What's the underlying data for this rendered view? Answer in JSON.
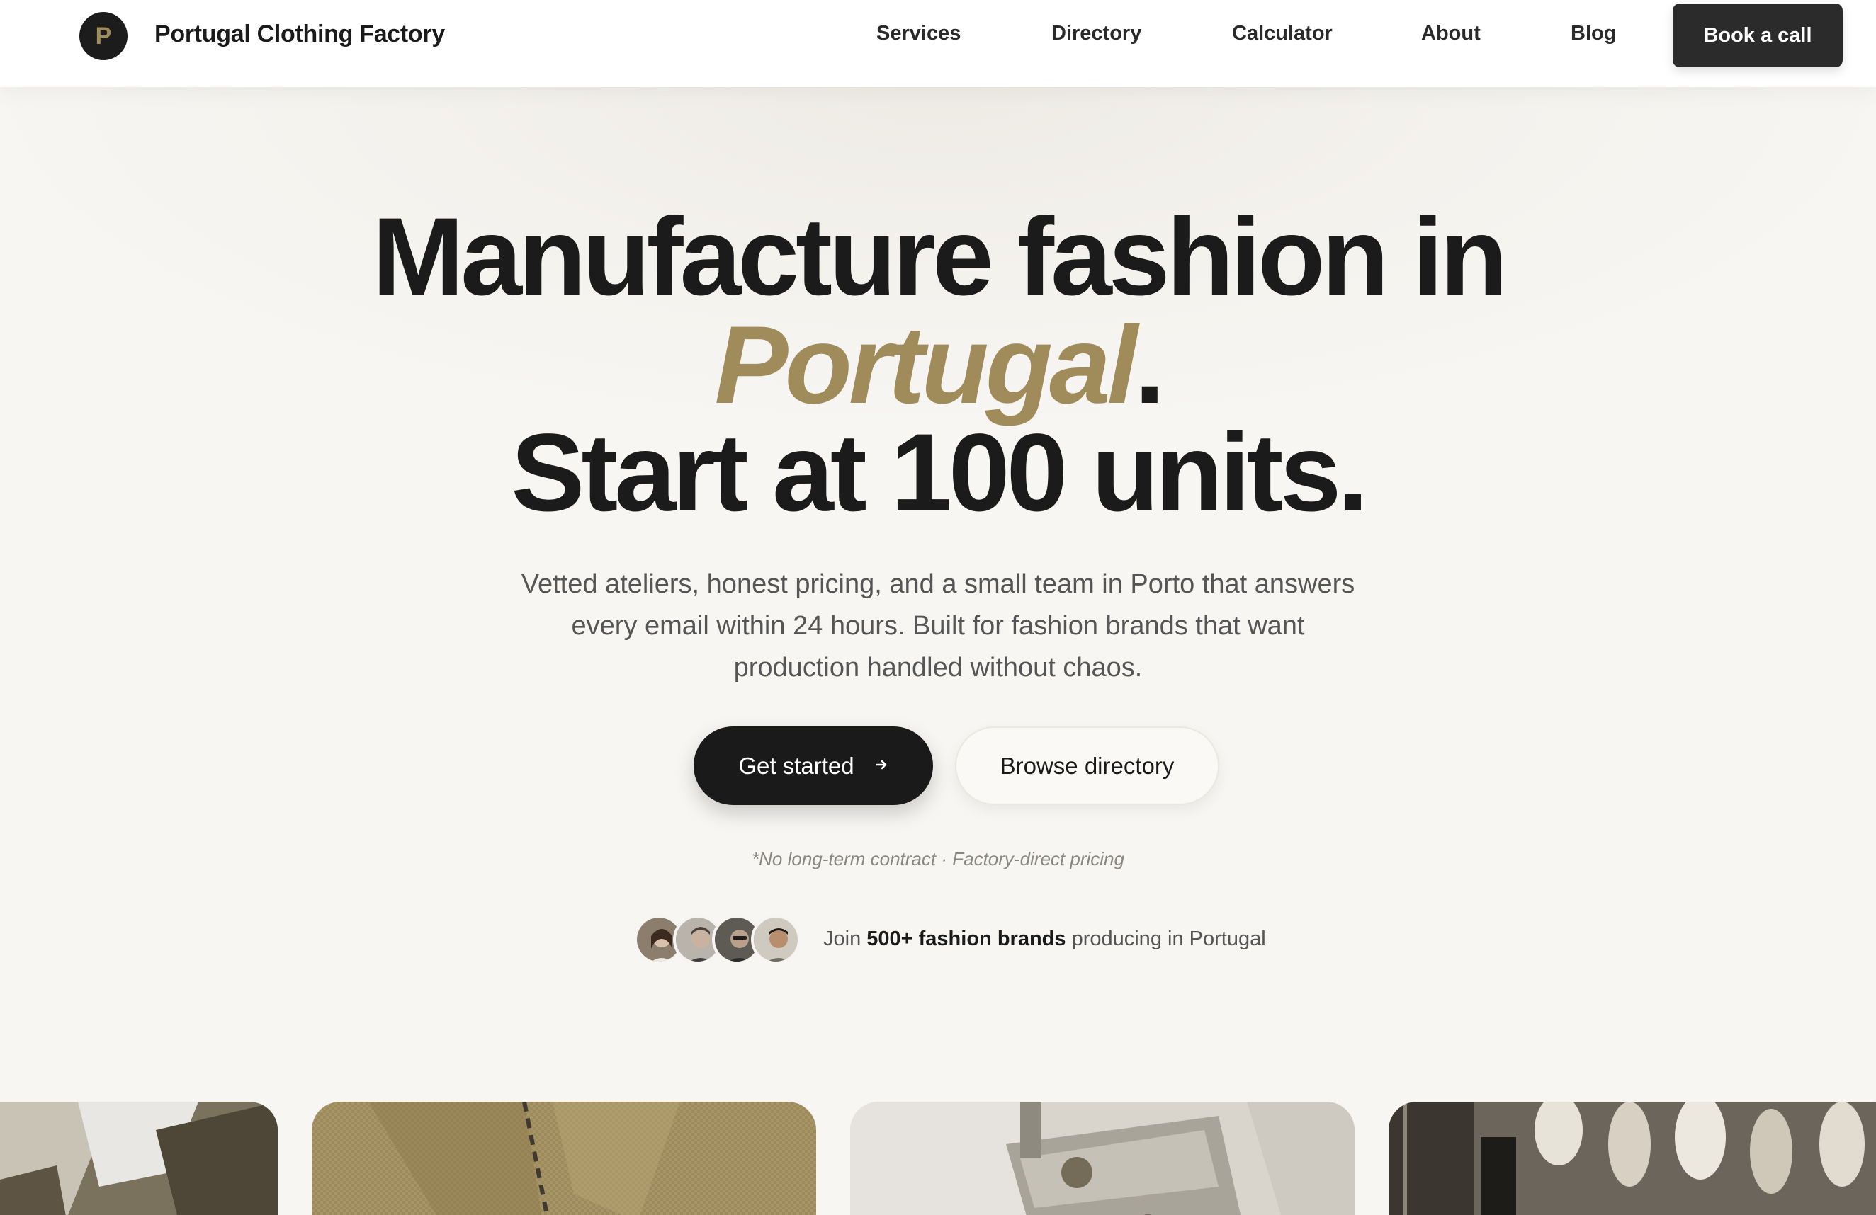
{
  "nav": {
    "logo_letter": "P",
    "brand": "Portugal Clothing Factory",
    "links": [
      "Services",
      "Directory",
      "Calculator",
      "About",
      "Blog"
    ],
    "cta": "Book a call"
  },
  "hero": {
    "line1": "Manufacture fashion in",
    "line2_accent": "Portugal",
    "line2_tail": ".",
    "line3": "Start at 100 units.",
    "subtitle": "Vetted ateliers, honest pricing, and a small team in Porto that answers every email within 24 hours. Built for fashion brands that want production handled without chaos.",
    "primary_button": "Get started",
    "primary_icon": "arrow-right-icon",
    "secondary_button": "Browse directory",
    "fineprint": "*No long-term contract · Factory-direct pricing",
    "social_prefix": "Join ",
    "social_bold": "500+ fashion brands",
    "social_suffix": " producing in Portugal"
  },
  "colors": {
    "accent": "#a08c5b",
    "dark": "#1a1a1a",
    "background": "#f4f2ed"
  },
  "gallery": [
    "sewing-hands-image",
    "collar-shirt-image",
    "sewing-machine-image",
    "mannequins-image"
  ]
}
